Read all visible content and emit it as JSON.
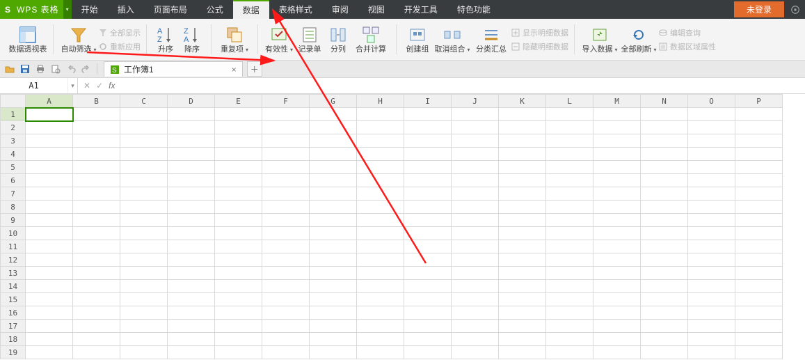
{
  "app": {
    "logo_letter": "S",
    "name": "WPS 表格",
    "login": "未登录"
  },
  "menu": {
    "items": [
      "开始",
      "插入",
      "页面布局",
      "公式",
      "数据",
      "表格样式",
      "审阅",
      "视图",
      "开发工具",
      "特色功能"
    ],
    "active_index": 4
  },
  "ribbon": {
    "pivot": "数据透视表",
    "filter": "自动筛选",
    "show_all": "全部显示",
    "reapply": "重新应用",
    "asc": "升序",
    "desc": "降序",
    "dup": "重复项",
    "validate": "有效性",
    "form": "记录单",
    "textcol": "分列",
    "consolidate": "合并计算",
    "group": "创建组",
    "ungroup": "取消组合",
    "subtotal": "分类汇总",
    "show_detail": "显示明细数据",
    "hide_detail": "隐藏明细数据",
    "import": "导入数据",
    "refresh": "全部刷新",
    "edit_query": "编辑查询",
    "range_prop": "数据区域属性"
  },
  "qa": {
    "doc_name": "工作簿1"
  },
  "fx": {
    "cellref": "A1",
    "fx_label": "fx",
    "value": ""
  },
  "grid": {
    "cols": [
      "A",
      "B",
      "C",
      "D",
      "E",
      "F",
      "G",
      "H",
      "I",
      "J",
      "K",
      "L",
      "M",
      "N",
      "O",
      "P"
    ],
    "row_count": 19,
    "sel_col": "A",
    "sel_row": 1
  }
}
